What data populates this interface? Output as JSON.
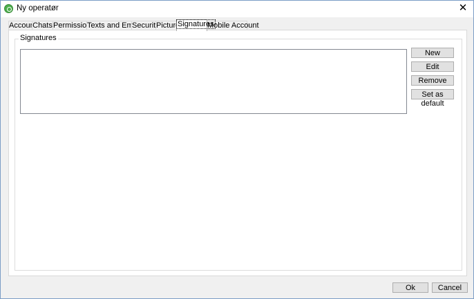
{
  "window": {
    "title": "Ny operatør",
    "close_glyph": "✕",
    "icon": "app-logo-icon"
  },
  "tabs": [
    {
      "label": "Account"
    },
    {
      "label": "Chats"
    },
    {
      "label": "Permissions"
    },
    {
      "label": "Texts and Emails"
    },
    {
      "label": "Security"
    },
    {
      "label": "Picture"
    },
    {
      "label": "Signatures",
      "active": true
    },
    {
      "label": "Mobile Account"
    }
  ],
  "signatures": {
    "group_label": "Signatures",
    "items": [],
    "buttons": {
      "new": "New",
      "edit": "Edit",
      "remove": "Remove",
      "set_default": "Set as default"
    }
  },
  "footer": {
    "ok": "Ok",
    "cancel": "Cancel"
  }
}
